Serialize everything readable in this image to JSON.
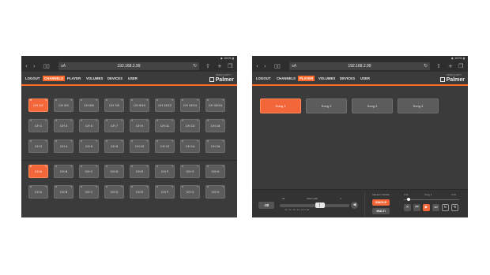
{
  "browser": {
    "text_size_label": "aA",
    "url": "192.168.2.99",
    "status_text": "100%"
  },
  "nav": {
    "items": [
      "LOGOUT",
      "CHANNELS",
      "PLAYER",
      "VOLUMES",
      "DEVICES",
      "USER"
    ]
  },
  "brand": {
    "logo_text": "Palmer",
    "logo_sub": "INNER CLARITY"
  },
  "channels": {
    "group1": {
      "row1": [
        "CH 1/2",
        "CH 3/4",
        "CH 5/6",
        "CH 7/8",
        "CH 9/10",
        "CH 11/12",
        "CH 13/14",
        "CH 15/16"
      ],
      "row2": [
        "CH 1",
        "CH 3",
        "CH 5",
        "CH 7",
        "CH 9",
        "CH 11",
        "CH 13",
        "CH 15"
      ],
      "row3": [
        "CH 2",
        "CH 4",
        "CH 6",
        "CH 8",
        "CH 10",
        "CH 12",
        "CH 14",
        "CH 16"
      ]
    },
    "group2": {
      "row1": [
        "CH A",
        "CH B",
        "CH C",
        "CH D",
        "CH E",
        "CH F",
        "CH G",
        "CH H"
      ],
      "row2": [
        "CH A",
        "CH B",
        "CH C",
        "CH D",
        "CH E",
        "CH F",
        "CH G",
        "CH H"
      ]
    },
    "active_pads": [
      "CH 1/2 (row 1)",
      "CH A (group 2 row 1)"
    ]
  },
  "player": {
    "songs": [
      "Song 1",
      "Song 2",
      "Song 3",
      "Song 4"
    ],
    "active_song": "Song 1",
    "volume_value": "-20",
    "volume_min": "-48",
    "volume_max": "0",
    "volume_label": "MAIN (dB)",
    "volume_ticks": "-48 -40 -30 -20 -10 0 dB",
    "select_mode_label": "SELECT MODE",
    "mode_single": "SINGLE",
    "mode_multi": "MULTI",
    "time_elapsed": "0:11",
    "now_playing": "Song 1",
    "time_total": "3:34",
    "progress_fraction": 0.05
  },
  "colors": {
    "accent": "#f2663a",
    "panel": "#3b3b3b",
    "pad": "#5c5c5c"
  }
}
